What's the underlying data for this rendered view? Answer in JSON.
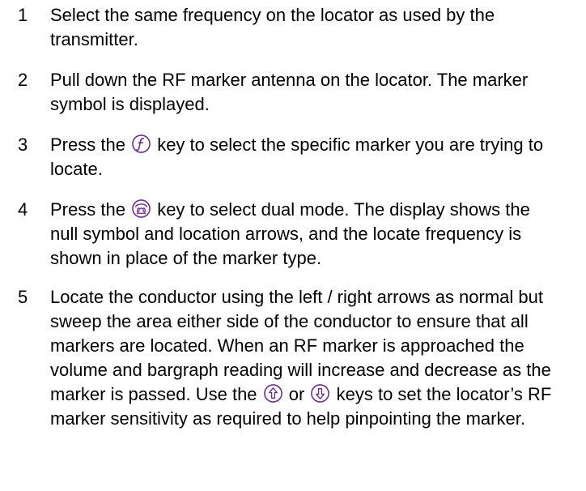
{
  "steps": [
    {
      "number": "1",
      "text": "Select the same frequency on the locator as used by the transmitter."
    },
    {
      "number": "2",
      "text": "Pull down the RF marker antenna on the locator. The marker symbol is displayed."
    },
    {
      "number": "3",
      "text_before": "Press the",
      "icon": "f-key-icon",
      "text_after": "key to select the specific marker you are trying to locate."
    },
    {
      "number": "4",
      "text_before": "Press the",
      "icon": "dual-mode-key-icon",
      "text_after": "key to select dual mode. The display shows the null symbol and location arrows, and the locate frequency is shown in place of the marker type."
    },
    {
      "number": "5",
      "text_1": "Locate the conductor using the left / right arrows as normal but sweep the area either side of the conductor to ensure that all markers are located. When an RF marker is approached the volume and bargraph reading will increase and decrease as the marker is passed. Use the",
      "icon_1": "up-arrow-key-icon",
      "text_2": "or",
      "icon_2": "down-arrow-key-icon",
      "text_3": "keys to set the locator’s RF marker sensitivity as required to help pinpointing the marker."
    }
  ],
  "colors": {
    "icon_stroke": "#6a2a8a",
    "text": "#000000"
  }
}
